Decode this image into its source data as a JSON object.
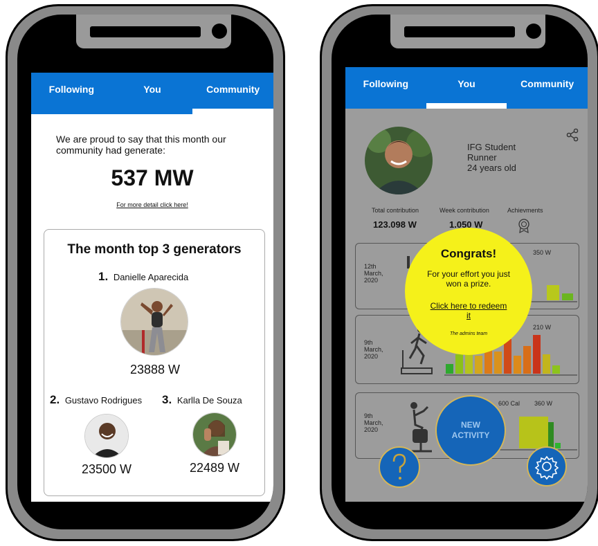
{
  "tabs": [
    "Following",
    "You",
    "Community"
  ],
  "community": {
    "intro": "We are proud to say that this month our community had generate:",
    "total": "537 MW",
    "detail_link": "For more detail click here!",
    "top_title": "The month top 3 generators",
    "top": [
      {
        "rank": "1.",
        "name": "Danielle Aparecida",
        "watts": "23888 W"
      },
      {
        "rank": "2.",
        "name": "Gustavo Rodrigues",
        "watts": "23500 W"
      },
      {
        "rank": "3.",
        "name": "Karlla De Souza",
        "watts": "22489 W"
      }
    ]
  },
  "profile": {
    "line1": "IFG Student",
    "line2": "Runner",
    "line3": "24 years old",
    "stats": [
      {
        "label": "Total contribution",
        "value": "123.098 W"
      },
      {
        "label": "Week contribution",
        "value": "1.050 W"
      },
      {
        "label": "Achievments",
        "value": ""
      }
    ],
    "activities": [
      {
        "date": [
          "12th",
          "March,",
          "2020"
        ],
        "kcal": "",
        "watts": "350 W"
      },
      {
        "date": [
          "9th",
          "March,",
          "2020"
        ],
        "kcal": "",
        "watts": "210 W"
      },
      {
        "date": [
          "9th",
          "March,",
          "2020"
        ],
        "kcal": "600 Cal",
        "watts": "360 W"
      }
    ],
    "popup": {
      "title": "Congrats!",
      "message": "For your effort you just won a prize.",
      "link": "Click here to redeem it",
      "sign": "The admins team"
    },
    "new_activity": [
      "NEW",
      "ACTIVITY"
    ],
    "help_glyph": "?"
  },
  "colors": {
    "tab_blue": "#0a74d4",
    "popup_yellow": "#f5f11a",
    "fab_blue": "#1565b8"
  }
}
